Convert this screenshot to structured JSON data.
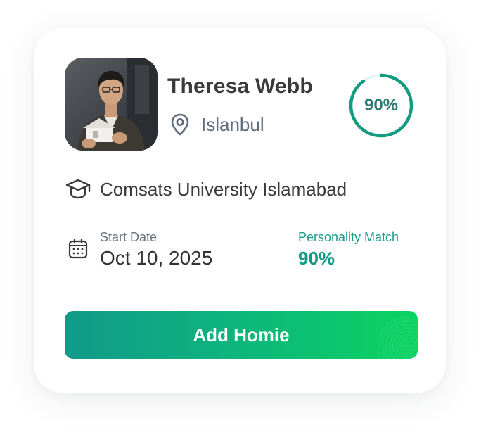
{
  "profile": {
    "name": "Theresa Webb",
    "location": "Islanbul",
    "match_badge": "90%",
    "match_fraction": 0.9,
    "avatar_icon": "profile-photo"
  },
  "education": {
    "icon": "graduation-cap-icon",
    "institution": "Comsats University Islamabad"
  },
  "details": {
    "start_date_label": "Start Date",
    "start_date_value": "Oct 10, 2025",
    "personality_match_label": "Personality Match",
    "personality_match_value": "90%"
  },
  "actions": {
    "add_label": "Add Homie"
  },
  "colors": {
    "accent": "#129a83",
    "ring_track": "#e3f8f4",
    "button_start": "#119a8b",
    "button_end": "#0bd460",
    "text_primary": "#3a3a3c",
    "text_secondary": "#5f6b7e"
  }
}
